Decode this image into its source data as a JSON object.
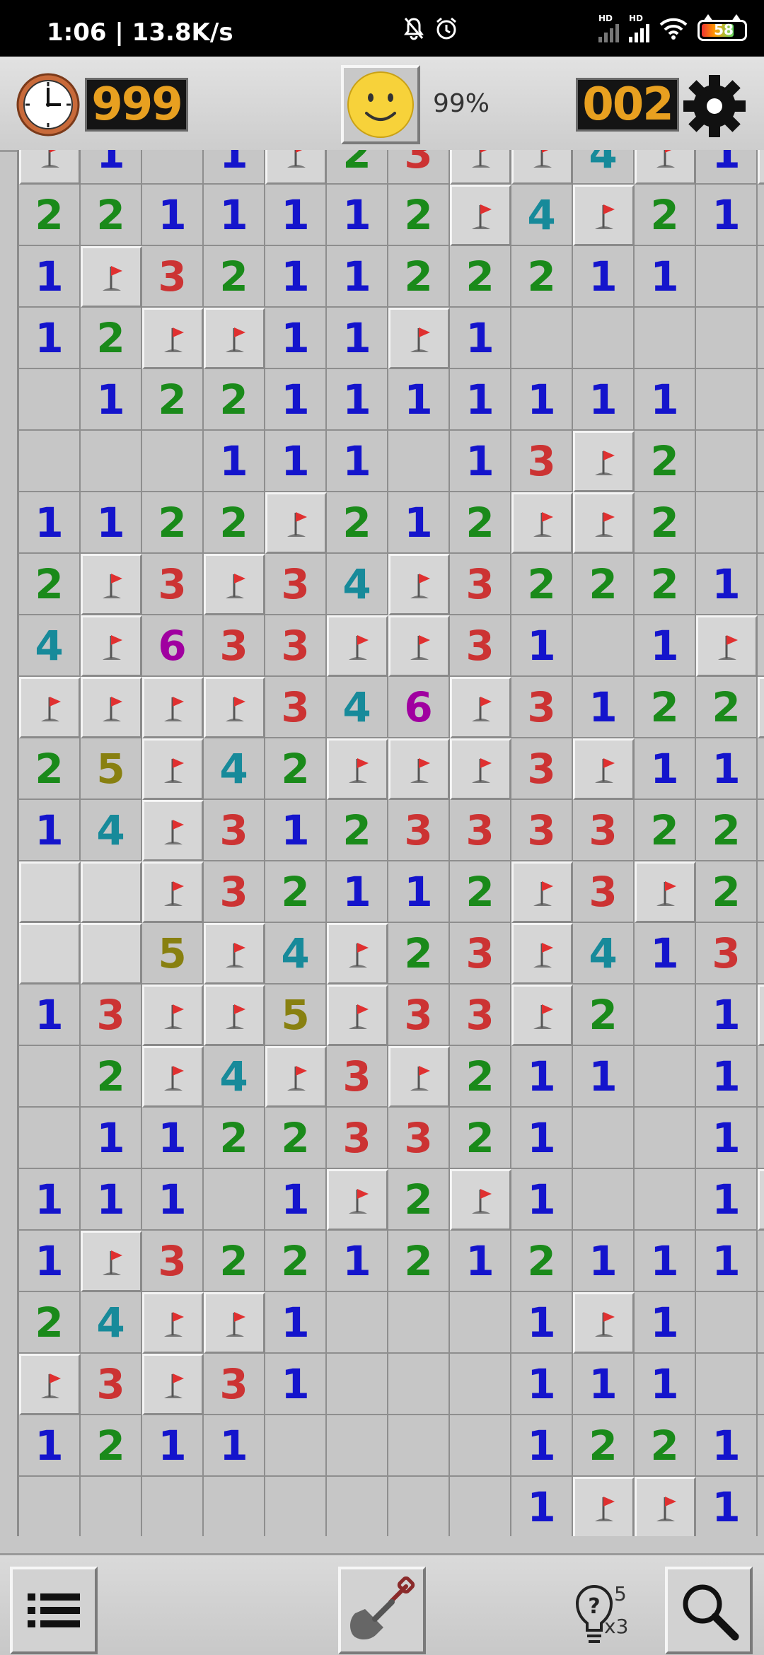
{
  "status_bar": {
    "time_speed": "1:06 | 13.8K/s",
    "signal1_label": "HD",
    "signal2_label": "HD",
    "battery": "58",
    "icons": [
      "mute-bell-icon",
      "alarm-icon",
      "signal-icon",
      "signal-icon",
      "wifi-icon",
      "battery-icon"
    ]
  },
  "header": {
    "timer": "999",
    "mines_left": "002",
    "progress": "99%",
    "face": "smiley",
    "icons": [
      "clock-icon",
      "smiley-face-icon",
      "gear-icon"
    ]
  },
  "board": {
    "columns": 13,
    "legend": "F = flagged raised tile, R = raised unopened tile, '' = opened empty, digit = opened number",
    "rows": [
      [
        "F",
        "1",
        "",
        "1",
        "F",
        "2",
        "3",
        "F",
        "F",
        "4",
        "F",
        "1",
        "F"
      ],
      [
        "2",
        "2",
        "1",
        "1",
        "1",
        "1",
        "2",
        "F",
        "4",
        "F",
        "2",
        "1",
        ""
      ],
      [
        "1",
        "F",
        "3",
        "2",
        "1",
        "1",
        "2",
        "2",
        "2",
        "1",
        "1",
        "",
        ""
      ],
      [
        "1",
        "2",
        "F",
        "F",
        "1",
        "1",
        "F",
        "1",
        "",
        "",
        "",
        "",
        ""
      ],
      [
        "",
        "1",
        "2",
        "2",
        "1",
        "1",
        "1",
        "1",
        "1",
        "1",
        "1",
        "",
        ""
      ],
      [
        "",
        "",
        "",
        "1",
        "1",
        "1",
        "",
        "1",
        "3",
        "F",
        "2",
        "",
        ""
      ],
      [
        "1",
        "1",
        "2",
        "2",
        "F",
        "2",
        "1",
        "2",
        "F",
        "F",
        "2",
        "",
        ""
      ],
      [
        "2",
        "F",
        "3",
        "F",
        "3",
        "4",
        "F",
        "3",
        "2",
        "2",
        "2",
        "1",
        ""
      ],
      [
        "4",
        "F",
        "6",
        "3",
        "3",
        "F",
        "F",
        "3",
        "1",
        "",
        "1",
        "F",
        ""
      ],
      [
        "F",
        "F",
        "F",
        "F",
        "3",
        "4",
        "6",
        "F",
        "3",
        "1",
        "2",
        "2",
        "R"
      ],
      [
        "2",
        "5",
        "F",
        "4",
        "2",
        "F",
        "F",
        "F",
        "3",
        "F",
        "1",
        "1",
        ""
      ],
      [
        "1",
        "4",
        "F",
        "3",
        "1",
        "2",
        "3",
        "3",
        "3",
        "3",
        "2",
        "2",
        ""
      ],
      [
        "R",
        "R",
        "F",
        "3",
        "2",
        "1",
        "1",
        "2",
        "F",
        "3",
        "F",
        "2",
        ""
      ],
      [
        "R",
        "R",
        "5",
        "F",
        "4",
        "F",
        "2",
        "3",
        "F",
        "4",
        "1",
        "3",
        ""
      ],
      [
        "1",
        "3",
        "F",
        "F",
        "5",
        "F",
        "3",
        "3",
        "F",
        "2",
        "",
        "1",
        "R"
      ],
      [
        "",
        "2",
        "F",
        "4",
        "F",
        "3",
        "F",
        "2",
        "1",
        "1",
        "",
        "1",
        ""
      ],
      [
        "",
        "1",
        "1",
        "2",
        "2",
        "3",
        "3",
        "2",
        "1",
        "",
        "",
        "1",
        ""
      ],
      [
        "1",
        "1",
        "1",
        "",
        "1",
        "F",
        "2",
        "F",
        "1",
        "",
        "",
        "1",
        "R"
      ],
      [
        "1",
        "F",
        "3",
        "2",
        "2",
        "1",
        "2",
        "1",
        "2",
        "1",
        "1",
        "1",
        ""
      ],
      [
        "2",
        "4",
        "F",
        "F",
        "1",
        "",
        "",
        "",
        "1",
        "F",
        "1",
        "",
        ""
      ],
      [
        "F",
        "3",
        "F",
        "3",
        "1",
        "",
        "",
        "",
        "1",
        "1",
        "1",
        "",
        ""
      ],
      [
        "1",
        "2",
        "1",
        "1",
        "",
        "",
        "",
        "",
        "1",
        "2",
        "2",
        "1",
        ""
      ],
      [
        "",
        "",
        "",
        "",
        "",
        "",
        "",
        "",
        "1",
        "F",
        "F",
        "1",
        ""
      ]
    ]
  },
  "footer": {
    "hint_count": "5",
    "hint_multiplier": "x3",
    "icons": [
      "list-menu-icon",
      "shovel-icon",
      "lightbulb-hint-icon",
      "magnifier-icon"
    ]
  },
  "colors": {
    "n1": "#1414cc",
    "n2": "#1a8a1a",
    "n3": "#cc3333",
    "n4": "#178a9a",
    "n5": "#888010",
    "n6": "#a000a0",
    "lcd_digits": "#e8a020",
    "flag": "#e03030"
  }
}
